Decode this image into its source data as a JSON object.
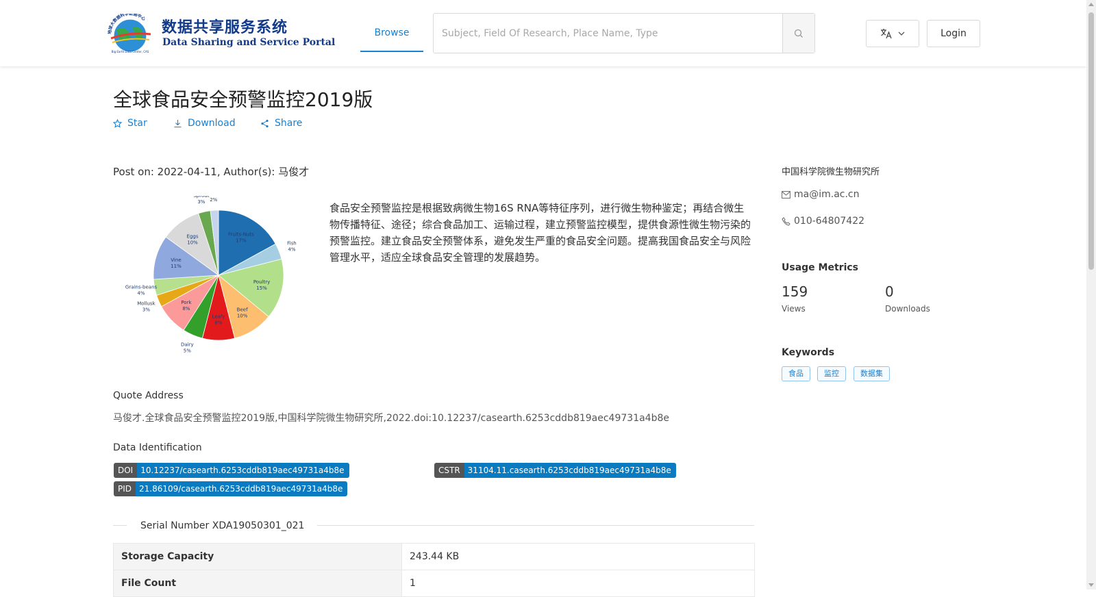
{
  "header": {
    "logo": {
      "cn_name": "数据共享服务系统",
      "en_name": "Data Sharing and Service Portal",
      "org_small": "地球大数据科学数据中心",
      "org_small_en": "Big Earth Data Center, CAS"
    },
    "nav": {
      "browse": "Browse"
    },
    "search": {
      "placeholder": "Subject, Field Of Research, Place Name, Type"
    },
    "language_icon": "translate-icon",
    "login": "Login"
  },
  "dataset": {
    "title": "全球食品安全预警监控2019版",
    "actions": {
      "star": "Star",
      "download": "Download",
      "share": "Share"
    },
    "post_line": "Post on: 2022-04-11, Author(s): 马俊才",
    "description": "食品安全预警监控是根据致病微生物16S RNA等特征序列，进行微生物种鉴定；再结合微生物传播特征、途径；综合食品加工、运输过程，建立预警监控模型，提供食源性微生物污染的预警监控。建立食品安全预警体系，避免发生严重的食品安全问题。提高我国食品安全与风险管理水平，适应全球食品安全管理的发展趋势。",
    "quote_title": "Quote Address",
    "quote_text": "马俊才.全球食品安全预警监控2019版,中国科学院微生物研究所,2022.doi:10.12237/casearth.6253cddb819aec49731a4b8e",
    "identification_title": "Data Identification",
    "identifiers": {
      "doi": {
        "key": "DOI",
        "value": "10.12237/casearth.6253cddb819aec49731a4b8e"
      },
      "cstr": {
        "key": "CSTR",
        "value": "31104.11.casearth.6253cddb819aec49731a4b8e"
      },
      "pid": {
        "key": "PID",
        "value": "21.86109/casearth.6253cddb819aec49731a4b8e"
      }
    },
    "serial_number": "Serial Number XDA19050301_021",
    "info_rows": [
      {
        "key": "Storage Capacity",
        "value": "243.44 KB"
      },
      {
        "key": "File Count",
        "value": "1"
      }
    ]
  },
  "sidebar": {
    "organization": "中国科学院微生物研究所",
    "email": "ma@im.ac.cn",
    "phone": "010-64807422",
    "usage_title": "Usage Metrics",
    "views": {
      "value": "159",
      "label": "Views"
    },
    "downloads": {
      "value": "0",
      "label": "Downloads"
    },
    "keywords_title": "Keywords",
    "keywords": [
      "食品",
      "监控",
      "数据集"
    ]
  },
  "chart_data": {
    "type": "pie",
    "title": "",
    "slices": [
      {
        "name": "Fruits-Nuts",
        "label": "17%",
        "value": 17,
        "color": "#1f6fb0"
      },
      {
        "name": "Fish",
        "label": "4%",
        "value": 4,
        "color": "#a6cee3"
      },
      {
        "name": "Poultry",
        "label": "15%",
        "value": 15,
        "color": "#b2df8a"
      },
      {
        "name": "Beef",
        "label": "10%",
        "value": 10,
        "color": "#fdbf6f"
      },
      {
        "name": "Leafy",
        "label": "8%",
        "value": 8,
        "color": "#e31a1c"
      },
      {
        "name": "Dairy",
        "label": "5%",
        "value": 5,
        "color": "#33a02c"
      },
      {
        "name": "Pork",
        "label": "8%",
        "value": 8,
        "color": "#fb9a99"
      },
      {
        "name": "Mollusk",
        "label": "3%",
        "value": 3,
        "color": "#e6a817"
      },
      {
        "name": "Grains-beans",
        "label": "4%",
        "value": 4,
        "color": "#b7e08e"
      },
      {
        "name": "Vine",
        "label": "11%",
        "value": 11,
        "color": "#8fa8de"
      },
      {
        "name": "Eggs",
        "label": "10%",
        "value": 10,
        "color": "#d9d9d9"
      },
      {
        "name": "Sprout",
        "label": "3%",
        "value": 3,
        "color": "#6aa84f"
      },
      {
        "name": "Other",
        "label": "2%",
        "value": 2,
        "color": "#c6d4ee"
      }
    ]
  }
}
